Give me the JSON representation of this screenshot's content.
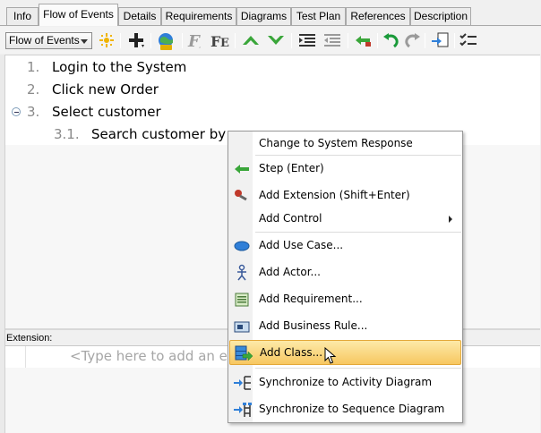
{
  "tabs": [
    {
      "label": "Info",
      "active": false
    },
    {
      "label": "Flow of Events",
      "active": true
    },
    {
      "label": "Details",
      "active": false
    },
    {
      "label": "Requirements",
      "active": false
    },
    {
      "label": "Diagrams",
      "active": false
    },
    {
      "label": "Test Plan",
      "active": false
    },
    {
      "label": "References",
      "active": false
    },
    {
      "label": "Description",
      "active": false
    }
  ],
  "toolbar": {
    "flow_select": "Flow of Events",
    "icons": [
      "new-flow-icon",
      "add-step-icon",
      "color-icon",
      "italic-f-icon",
      "format-fe-icon",
      "move-up-icon",
      "move-down-icon",
      "indent-icon",
      "outdent-icon",
      "extension-icon",
      "undo-icon",
      "redo-icon",
      "link-icon",
      "checklist-icon"
    ]
  },
  "steps": [
    {
      "num": "1.",
      "text": "Login to the System"
    },
    {
      "num": "2.",
      "text": "Click new Order"
    },
    {
      "num": "3.",
      "text": "Select customer"
    },
    {
      "num": "3.1.",
      "text": "Search customer by"
    }
  ],
  "extension": {
    "label": "Extension:",
    "placeholder": "<Type here to add an ex"
  },
  "context_menu": {
    "items": [
      {
        "label": "Change to System Response",
        "icon": ""
      },
      {
        "label": "Step (Enter)",
        "icon": "step-arrow-icon"
      },
      {
        "label": "Add Extension (Shift+Enter)",
        "icon": "extension-icon"
      },
      {
        "label": "Add Control",
        "icon": "",
        "submenu": true
      },
      {
        "label": "Add Use Case...",
        "icon": "use-case-icon"
      },
      {
        "label": "Add Actor...",
        "icon": "actor-icon"
      },
      {
        "label": "Add Requirement...",
        "icon": "requirement-icon"
      },
      {
        "label": "Add Business Rule...",
        "icon": "business-rule-icon"
      },
      {
        "label": "Add Class...",
        "icon": "class-icon",
        "hover": true
      },
      {
        "label": "Synchronize to Activity Diagram",
        "icon": "activity-diagram-icon"
      },
      {
        "label": "Synchronize to Sequence Diagram",
        "icon": "sequence-diagram-icon"
      }
    ]
  },
  "colors": {
    "accent_hover": "#f7c761",
    "green_arrow": "#3aa63a",
    "use_case_blue": "#2f7fd8"
  }
}
